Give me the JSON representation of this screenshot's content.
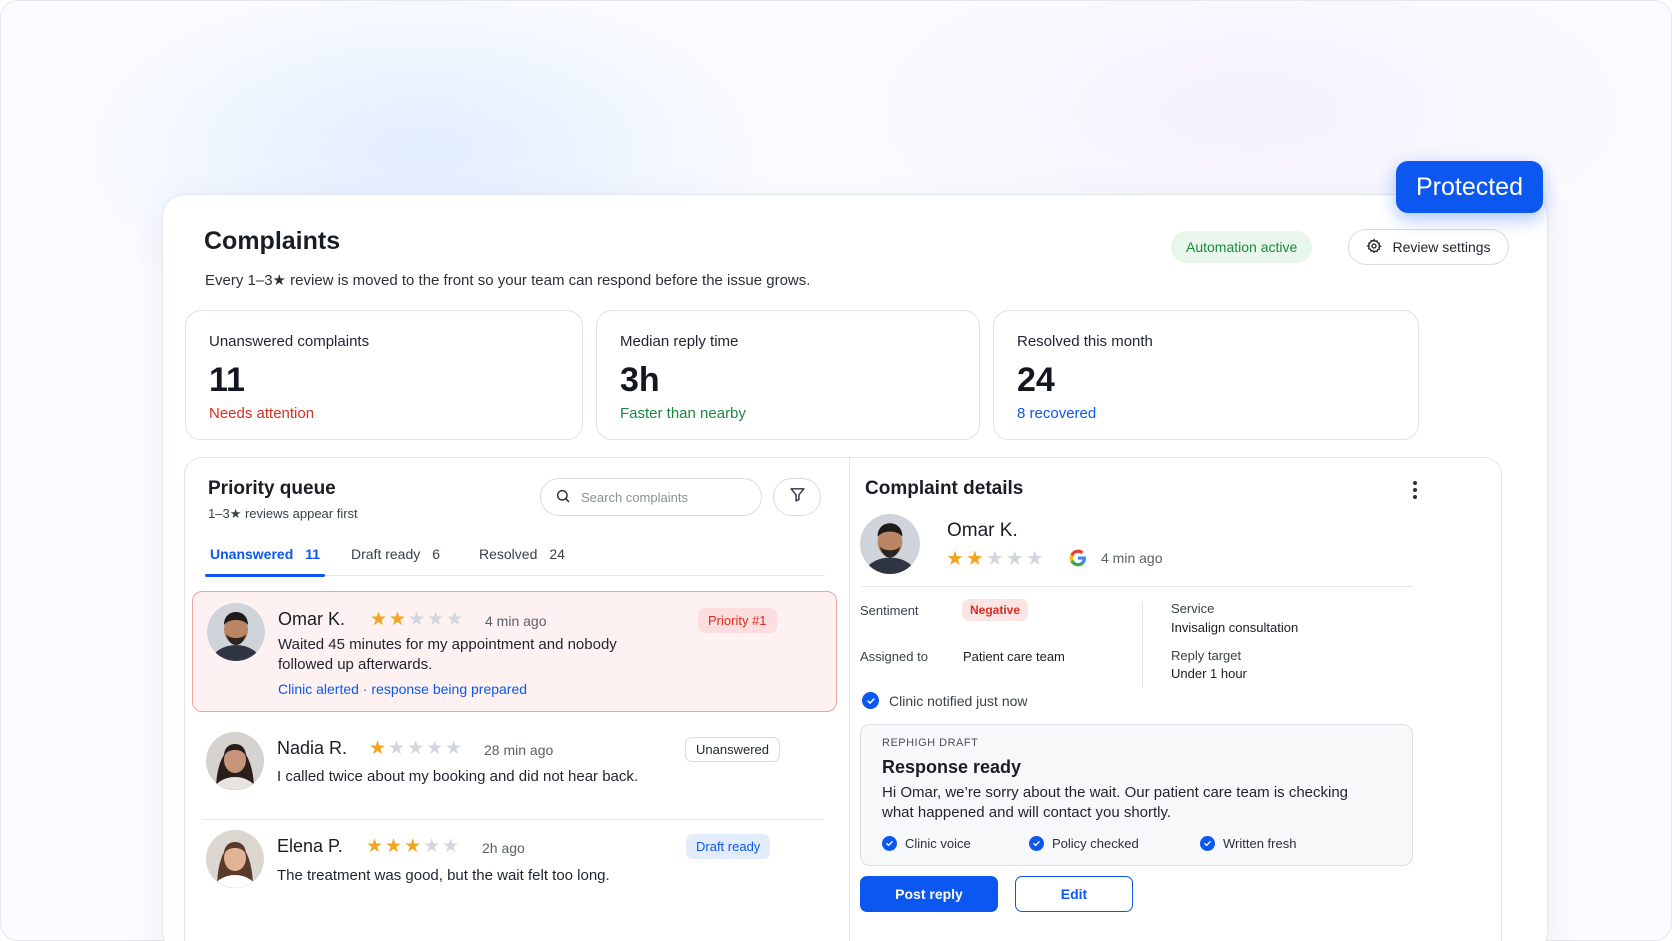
{
  "badge": "Protected",
  "header": {
    "title": "Complaints",
    "subtitle": "Every 1–3★ review is moved to the front so your team can respond before the issue grows.",
    "automation": "Automation active",
    "settings_label": "Review settings"
  },
  "stats": [
    {
      "label": "Unanswered complaints",
      "value": "11",
      "note": "Needs attention",
      "note_color": "#d92d20"
    },
    {
      "label": "Median reply time",
      "value": "3h",
      "note": "Faster than nearby",
      "note_color": "#1a8a3c"
    },
    {
      "label": "Resolved this month",
      "value": "24",
      "note": "8 recovered",
      "note_color": "#0b57f0"
    }
  ],
  "queue": {
    "title": "Priority queue",
    "subtitle": "1–3★ reviews appear first",
    "search_placeholder": "Search complaints",
    "tabs": [
      {
        "label": "Unanswered",
        "count": "11"
      },
      {
        "label": "Draft ready",
        "count": "6"
      },
      {
        "label": "Resolved",
        "count": "24"
      }
    ],
    "items": [
      {
        "name": "Omar K.",
        "rating": 2,
        "time": "4 min ago",
        "text_line1": "Waited 45 minutes for my appointment and nobody",
        "text_line2": "followed up afterwards.",
        "status_link": "Clinic alerted · response being prepared",
        "badge": "Priority #1"
      },
      {
        "name": "Nadia R.",
        "rating": 1,
        "time": "28 min ago",
        "text_line1": "I called twice about my booking and did not hear back.",
        "badge": "Unanswered"
      },
      {
        "name": "Elena P.",
        "rating": 3,
        "time": "2h ago",
        "text_line1": "The treatment was good, but the wait felt too long.",
        "badge": "Draft ready"
      }
    ]
  },
  "details": {
    "title": "Complaint details",
    "name": "Omar K.",
    "rating": 2,
    "time": "4 min ago",
    "sentiment_label": "Sentiment",
    "sentiment_value": "Negative",
    "assigned_label": "Assigned to",
    "assigned_value": "Patient care team",
    "service_label": "Service",
    "service_value": "Invisalign consultation",
    "target_label": "Reply target",
    "target_value": "Under 1 hour",
    "notified": "Clinic notified just now",
    "draft": {
      "eyebrow": "REPHIGH DRAFT",
      "heading": "Response ready",
      "body_line1": "Hi Omar, we’re sorry about the wait. Our patient care team is checking",
      "body_line2": "what happened and will contact you shortly.",
      "checks": [
        "Clinic voice",
        "Policy checked",
        "Written fresh"
      ]
    },
    "post_label": "Post reply",
    "edit_label": "Edit"
  }
}
